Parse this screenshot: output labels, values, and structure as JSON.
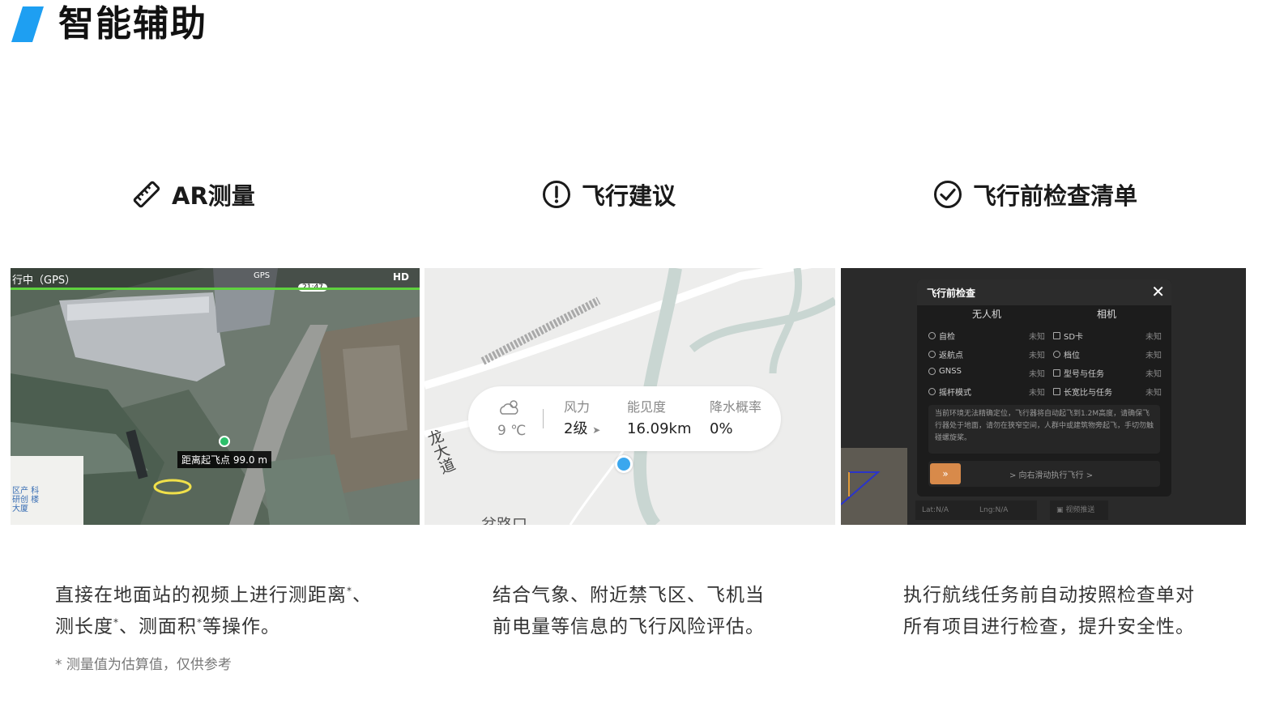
{
  "header": {
    "title": "智能辅助",
    "accent_color": "#1e9ff2"
  },
  "features": [
    {
      "title": "AR测量",
      "icon": "ruler-icon",
      "description_parts": [
        "直接在地面站的视频上进行测距离",
        "、",
        "测长度",
        "、测面积",
        "等操作。"
      ],
      "footnote_mark": "*",
      "note": "* 测量值为估算值，仅供参考",
      "screen": {
        "mode": "行中（GPS）",
        "gps": "GPS",
        "time": "21:47",
        "hd": "HD",
        "distance_label": "距离起飞点 99.0 m",
        "minimap_text": "区产 科研创 楼大厦"
      }
    },
    {
      "title": "飞行建议",
      "icon": "alert-circle-icon",
      "description_lines": [
        "结合气象、附近禁飞区、飞机当",
        "前电量等信息的飞行风险评估。"
      ],
      "screen": {
        "temperature": "9 ℃",
        "wind_label": "风力",
        "wind_value": "2级",
        "visibility_label": "能见度",
        "visibility_value": "16.09km",
        "precip_label": "降水概率",
        "precip_value": "0%",
        "road_label": "龙大道",
        "road_label_2": "岔路口"
      }
    },
    {
      "title": "飞行前检查清单",
      "icon": "check-circle-icon",
      "description_lines": [
        "执行航线任务前自动按照检查单对",
        "所有项目进行检查，提升安全性。"
      ],
      "screen": {
        "dialog_title": "飞行前检查",
        "col_drone": "无人机",
        "col_camera": "相机",
        "drone_items": [
          {
            "label": "自检",
            "status": "未知"
          },
          {
            "label": "返航点",
            "status": "未知"
          },
          {
            "label": "GNSS",
            "status": "未知"
          },
          {
            "label": "摇杆模式",
            "status": "未知"
          }
        ],
        "camera_items": [
          {
            "label": "SD卡",
            "status": "未知"
          },
          {
            "label": "档位",
            "status": "未知"
          },
          {
            "label": "型号与任务",
            "status": "未知"
          },
          {
            "label": "长宽比与任务",
            "status": "未知"
          }
        ],
        "notice": "当前环境无法精确定位，飞行器将自动起飞到1.2M高度，请确保飞行器处于地面，请勿在狭窄空间，人群中或建筑物旁起飞，手切勿触碰螺旋桨。",
        "slide_text": "> 向右滑动执行飞行 >",
        "slide_btn": "»",
        "lat": "Lat:N/A",
        "lng": "Lng:N/A",
        "video_push": "视频推送"
      }
    }
  ]
}
